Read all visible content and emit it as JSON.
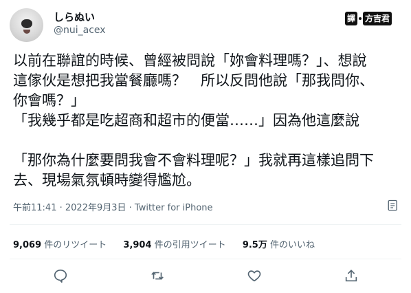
{
  "author": {
    "display_name": "しらぬい",
    "handle": "@nui_acex"
  },
  "badge": {
    "left_text": "譯",
    "right_text": "方吉君"
  },
  "tweet": {
    "lines": [
      "以前在聯誼的時候、曾經被問說「妳會料理嗎？」、想說",
      "這傢伙是想把我當餐廳嗎？　所以反問他說「那我問你、",
      "你會嗎？」",
      "「我幾乎都是吃超商和超市的便當……」因為他這麼說",
      "",
      "「那你為什麼要問我會不會料理呢？」我就再這樣追問下",
      "去、現場氣氛頓時變得尷尬。"
    ]
  },
  "meta": {
    "time": "午前11:41",
    "sep1": " · ",
    "date": "2022年9月3日",
    "sep2": " · ",
    "source": "Twitter for iPhone"
  },
  "stats": {
    "retweets_count": "9,069",
    "retweets_label": " 件のリツイート",
    "quotes_count": "3,904",
    "quotes_label": " 件の引用ツイート",
    "likes_count": "9.5万",
    "likes_label": " 件のいいね"
  },
  "icons": {
    "analytics": "analytics-icon",
    "reply": "reply-icon",
    "retweet": "retweet-icon",
    "like": "heart-icon",
    "share": "share-icon"
  },
  "colors": {
    "text": "#0f1419",
    "muted": "#536471",
    "divider": "#eff3f4"
  }
}
